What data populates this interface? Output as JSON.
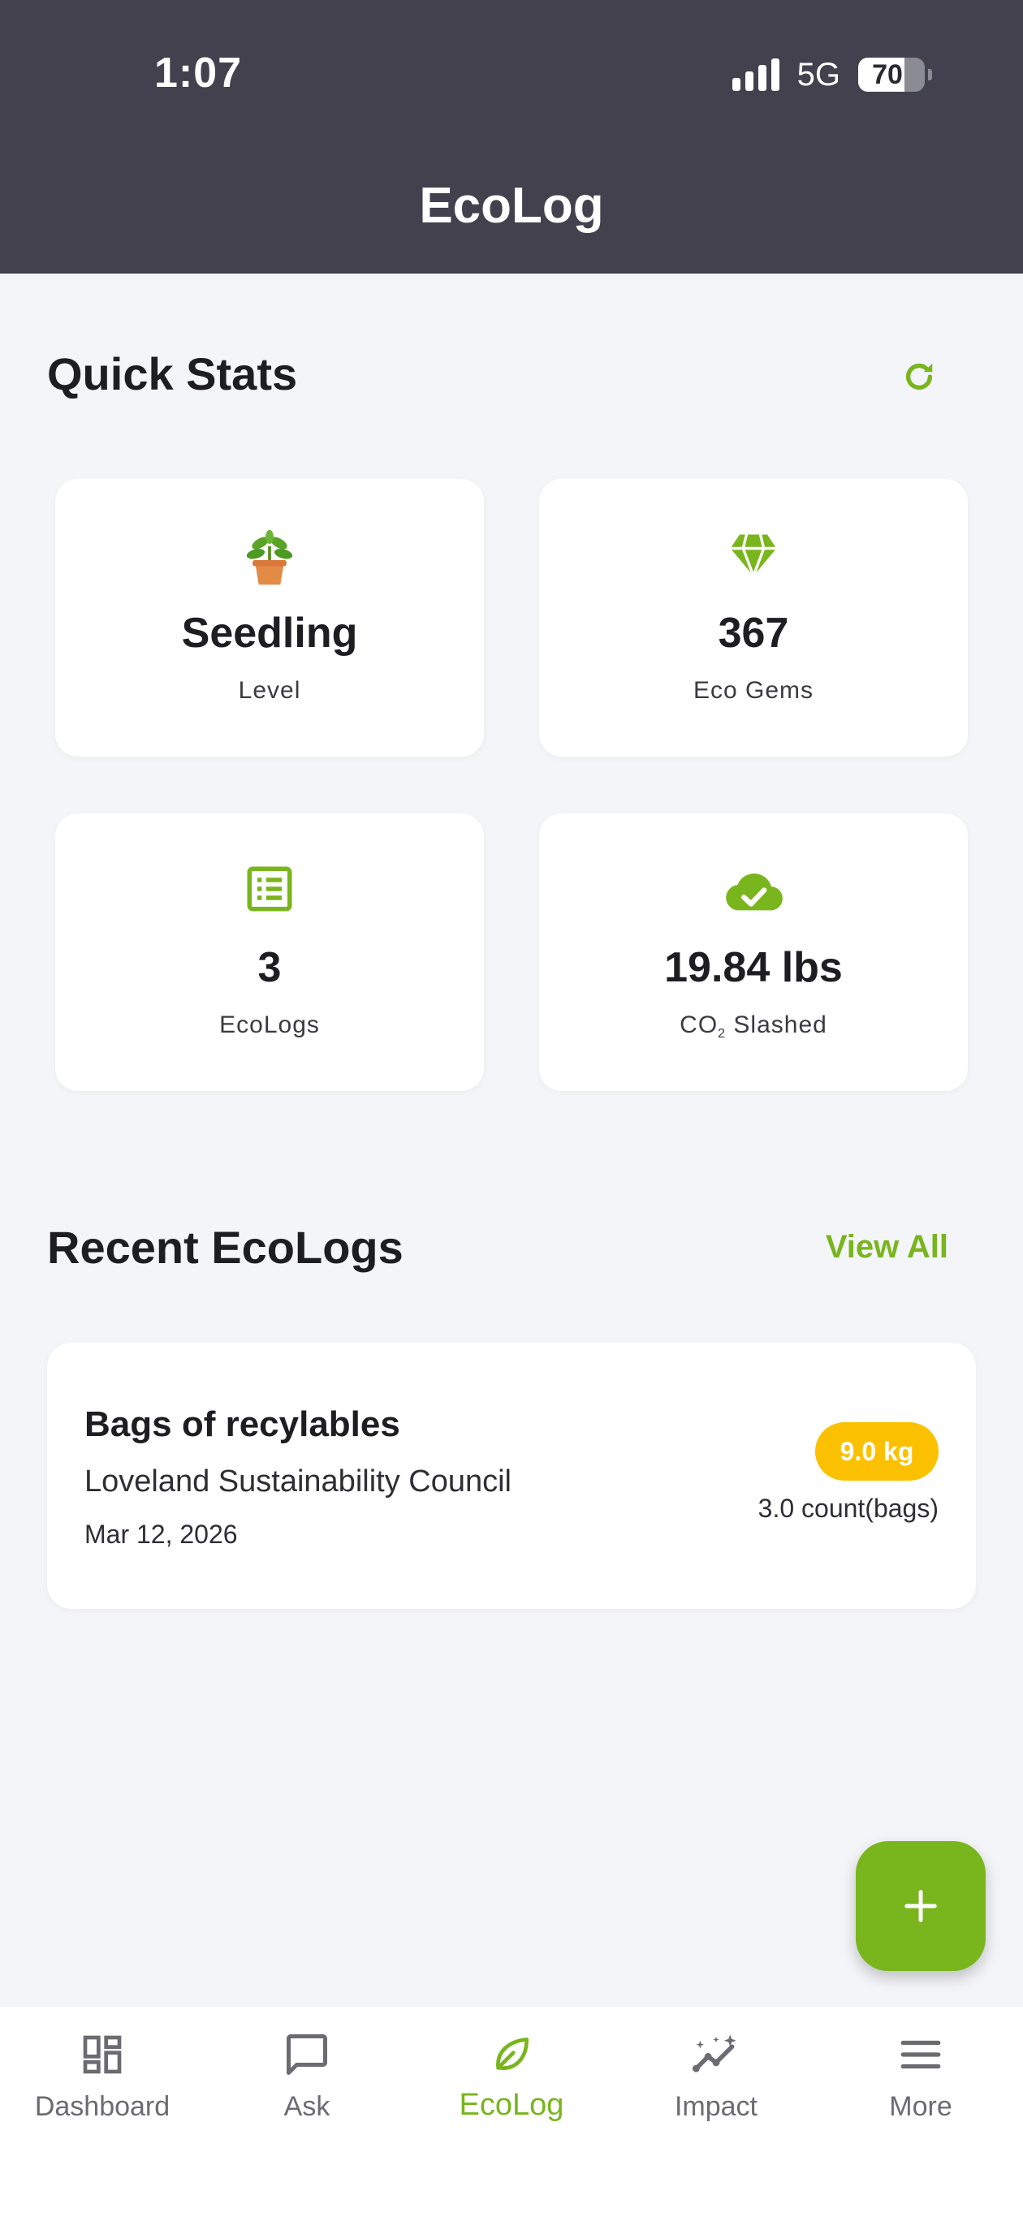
{
  "status_bar": {
    "time": "1:07",
    "network": "5G",
    "battery_percent": "70",
    "battery_level": 0.7
  },
  "header": {
    "title": "EcoLog"
  },
  "quick_stats": {
    "title": "Quick Stats",
    "refresh_icon": "refresh-icon",
    "cards": [
      {
        "icon": "seedling-pot-icon",
        "value": "Seedling",
        "label": "Level"
      },
      {
        "icon": "gem-icon",
        "value": "367",
        "label": "Eco Gems"
      },
      {
        "icon": "list-icon",
        "value": "3",
        "label": "EcoLogs"
      },
      {
        "icon": "cloud-check-icon",
        "value": "19.84 lbs",
        "label_prefix": "CO",
        "label_sub": "2",
        "label_suffix": " Slashed"
      }
    ]
  },
  "recent": {
    "title": "Recent EcoLogs",
    "view_all": "View All",
    "logs": [
      {
        "title": "Bags of recylables",
        "organization": "Loveland Sustainability Council",
        "date": "Mar 12, 2026",
        "badge": "9.0 kg",
        "count": "3.0 count(bags)"
      }
    ]
  },
  "fab": {
    "icon": "plus-icon"
  },
  "bottom_nav": {
    "items": [
      {
        "label": "Dashboard",
        "icon": "dashboard-icon"
      },
      {
        "label": "Ask",
        "icon": "chat-bubble-icon"
      },
      {
        "label": "EcoLog",
        "icon": "leaf-icon",
        "active": true
      },
      {
        "label": "Impact",
        "icon": "sparkle-chart-icon"
      },
      {
        "label": "More",
        "icon": "menu-icon"
      }
    ]
  },
  "colors": {
    "accent": "#79b51c",
    "header_bg": "#42414d",
    "page_bg": "#f4f5f9",
    "badge": "#fbc100"
  }
}
